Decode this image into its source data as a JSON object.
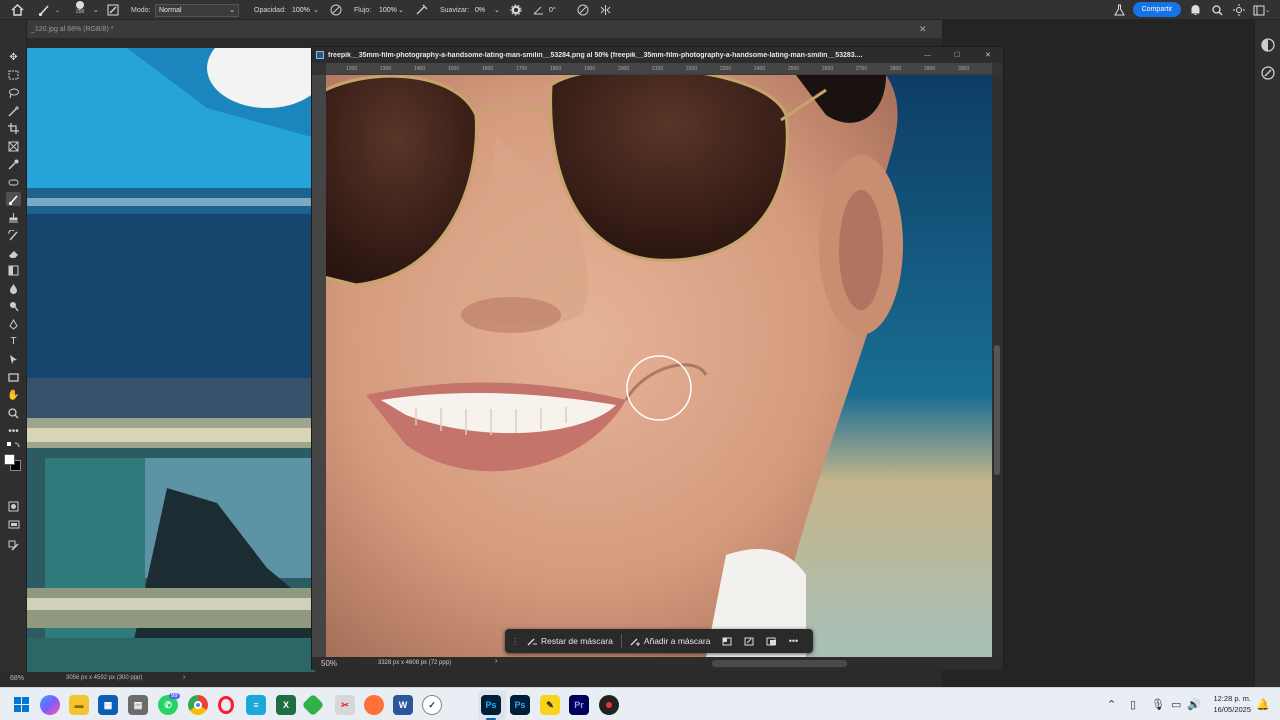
{
  "options_bar": {
    "brush_size": "250",
    "mode_label": "Modo:",
    "mode_value": "Normal",
    "opacity_label": "Opacidad:",
    "opacity_value": "100%",
    "flow_label": "Flujo:",
    "flow_value": "100%",
    "smoothing_label": "Suavizar:",
    "smoothing_value": "0%",
    "angle_value": "0°",
    "share_label": "Compartir"
  },
  "background_doc": {
    "tab_title": "_120.jpg al 68% (RGB/8) *",
    "zoom": "68%",
    "dimensions": "3056 px x 4592 px (300 ppp)"
  },
  "floating_doc": {
    "title": "freepik__35mm-film-photography-a-handsome-lating-man-smilin__53284.png al 50% (freepik__35mm-film-photography-a-handsome-lating-man-smilin__53283....",
    "ruler_ticks": [
      "1200",
      "1300",
      "1400",
      "1500",
      "1600",
      "1700",
      "1800",
      "1900",
      "2000",
      "2100",
      "2200",
      "2300",
      "2400",
      "2500",
      "2600",
      "2700",
      "2800",
      "2900",
      "3000"
    ],
    "zoom": "50%",
    "dimensions": "3328 px x 4608 px (72 ppp)"
  },
  "context_bar": {
    "subtract_label": "Restar de máscara",
    "add_label": "Añadir a máscara"
  },
  "taskbar": {
    "whatsapp_badge": "99",
    "time": "12:28 p. m.",
    "date": "16/05/2025"
  }
}
